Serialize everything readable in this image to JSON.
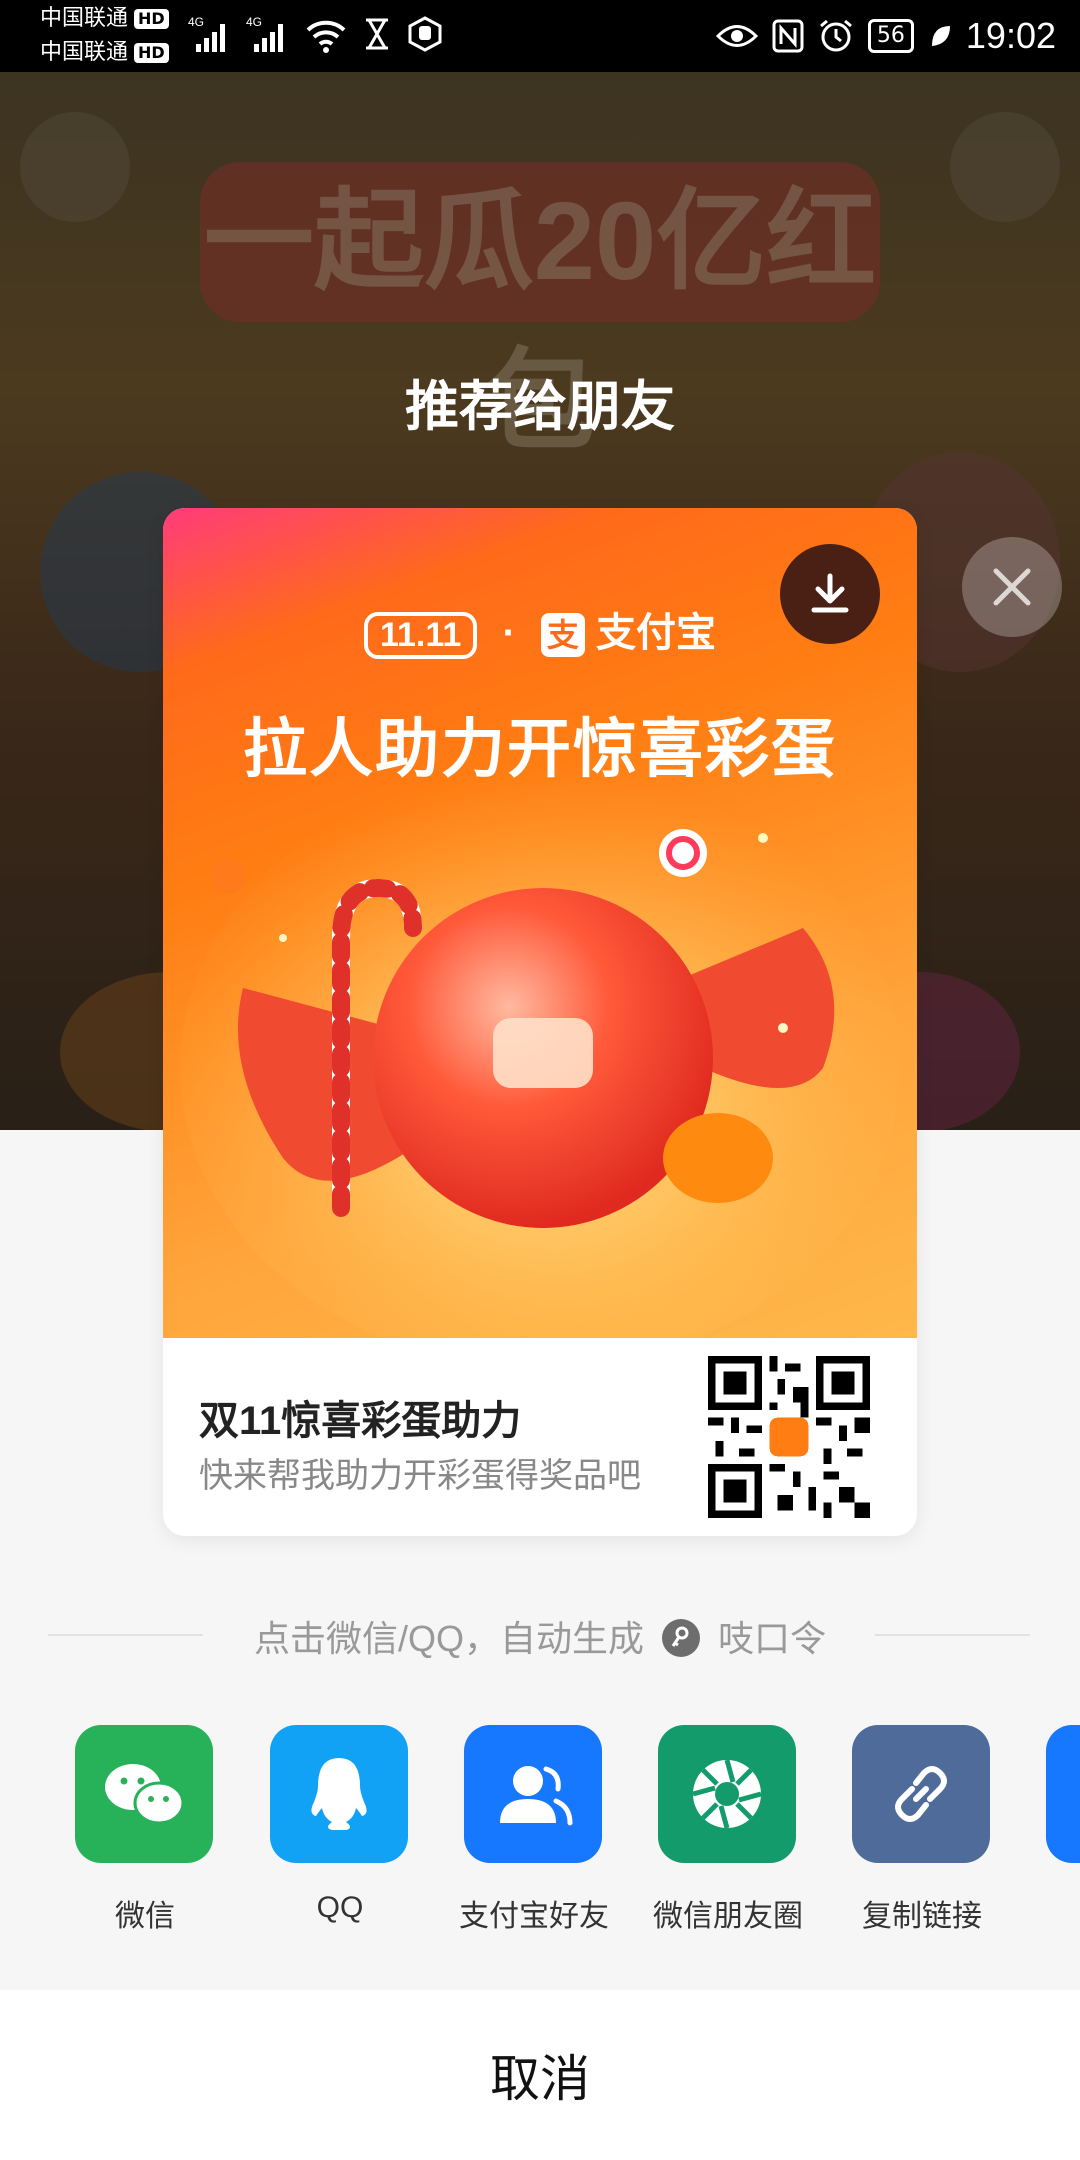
{
  "status_bar": {
    "carrier_1": "中国联通",
    "carrier_2": "中国联通",
    "hd_badge": "HD",
    "network": "4G",
    "battery": "56",
    "time": "19:02"
  },
  "background": {
    "promo_title": "一起瓜20亿红包"
  },
  "dialog": {
    "title": "推荐给朋友",
    "poster": {
      "brand_logo_text": "11.11",
      "brand_separator": "·",
      "brand_name": "支付宝",
      "headline": "拉人助力开惊喜彩蛋",
      "card_title": "双11惊喜彩蛋助力",
      "card_subtitle": "快来帮我助力开彩蛋得奖品吧"
    },
    "hint": {
      "before": "点击微信/QQ，自动生成",
      "after": "吱口令"
    },
    "share_targets": [
      {
        "label": "微信",
        "icon": "wechat-icon",
        "color": "#27b25a"
      },
      {
        "label": "QQ",
        "icon": "qq-icon",
        "color": "#12a2f5"
      },
      {
        "label": "支付宝好友",
        "icon": "alipay-friends-icon",
        "color": "#1677ff"
      },
      {
        "label": "微信朋友圈",
        "icon": "wechat-moments-icon",
        "color": "#139b6c"
      },
      {
        "label": "复制链接",
        "icon": "link-icon",
        "color": "#4f6b9a"
      }
    ],
    "cancel_label": "取消"
  },
  "colors": {
    "accent_orange": "#ff7d12",
    "download_button": "#4a2014"
  }
}
